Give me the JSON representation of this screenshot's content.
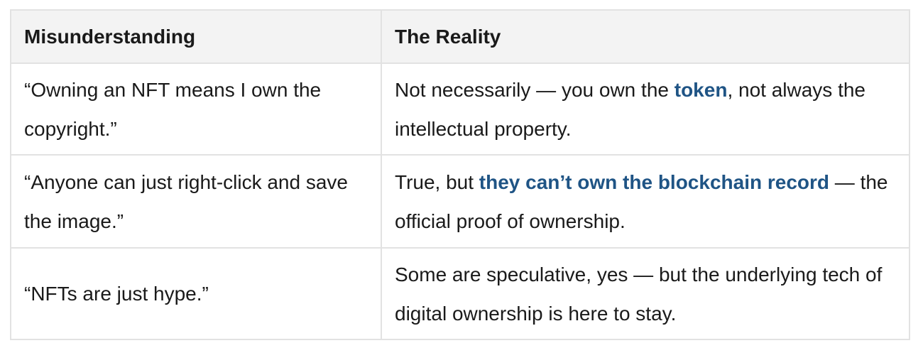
{
  "table": {
    "headers": [
      "Misunderstanding",
      "The Reality"
    ],
    "rows": [
      {
        "misunderstanding": "“Owning an NFT means I own the copyright.”",
        "reality": {
          "before": "Not necessarily — you own the ",
          "highlight": "token",
          "after": ", not always the intellectual property."
        }
      },
      {
        "misunderstanding": "“Anyone can just right-click and save the image.”",
        "reality": {
          "before": "True, but ",
          "highlight": "they can’t own the blockchain record",
          "after": " — the official proof of ownership."
        }
      },
      {
        "misunderstanding": "“NFTs are just hype.”",
        "reality": {
          "before": "Some are speculative, yes — but the underlying tech of digital ownership is here to stay.",
          "highlight": "",
          "after": ""
        }
      }
    ],
    "highlight_color": "#1f5485"
  }
}
